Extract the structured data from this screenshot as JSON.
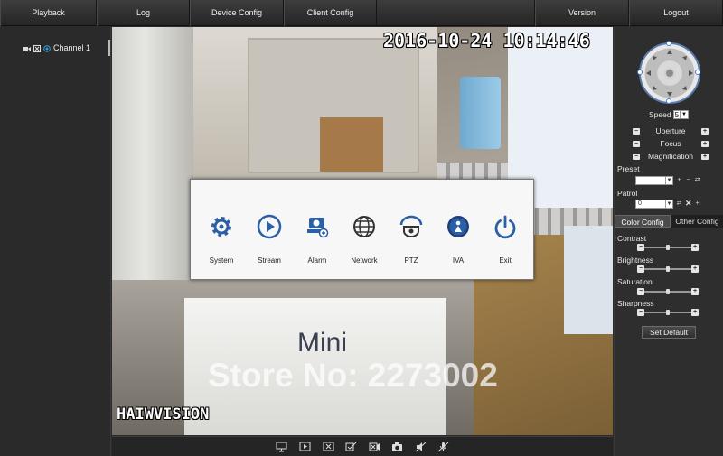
{
  "nav": {
    "playback": "Playback",
    "log": "Log",
    "device_config": "Device Config",
    "client_config": "Client Config",
    "version": "Version",
    "logout": "Logout"
  },
  "tree": {
    "channel": "Channel 1"
  },
  "video": {
    "timestamp": "2016-10-24  10:14:46",
    "osd_name": "HAIWVISION",
    "watermark": "Store No: 2273002",
    "scene_text": "Mini"
  },
  "menu": {
    "items": [
      {
        "label": "System",
        "icon": "gear-icon"
      },
      {
        "label": "Stream",
        "icon": "play-icon"
      },
      {
        "label": "Alarm",
        "icon": "alarm-camera-icon"
      },
      {
        "label": "Network",
        "icon": "globe-icon"
      },
      {
        "label": "PTZ",
        "icon": "ptz-dome-icon"
      },
      {
        "label": "IVA",
        "icon": "iva-icon"
      },
      {
        "label": "Exit",
        "icon": "power-icon"
      }
    ]
  },
  "toolbar": {
    "icons": [
      "monitor-icon",
      "play-window-icon",
      "close-window-icon",
      "check-video-icon",
      "close-video-icon",
      "snapshot-icon",
      "mute-icon",
      "mic-off-icon"
    ]
  },
  "ptz": {
    "speed_label": "Speed",
    "speed_value": "5",
    "aperture": "Uperture",
    "focus": "Focus",
    "magnification": "Magnification",
    "preset_label": "Preset",
    "preset_value": "",
    "patrol_label": "Patrol",
    "patrol_value": "0"
  },
  "image_config": {
    "tab_color": "Color Config",
    "tab_other": "Other Config",
    "contrast": "Contrast",
    "contrast_level": 0.5,
    "brightness": "Brightness",
    "brightness_level": 0.5,
    "saturation": "Saturation",
    "saturation_level": 0.5,
    "sharpness": "Sharpness",
    "sharpness_level": 0.5,
    "set_default": "Set Default"
  },
  "colors": {
    "ptz_ring": "#5a7ab0",
    "panel_bg": "#2e2e2e",
    "menu_icon_blue": "#2b5fa6"
  }
}
